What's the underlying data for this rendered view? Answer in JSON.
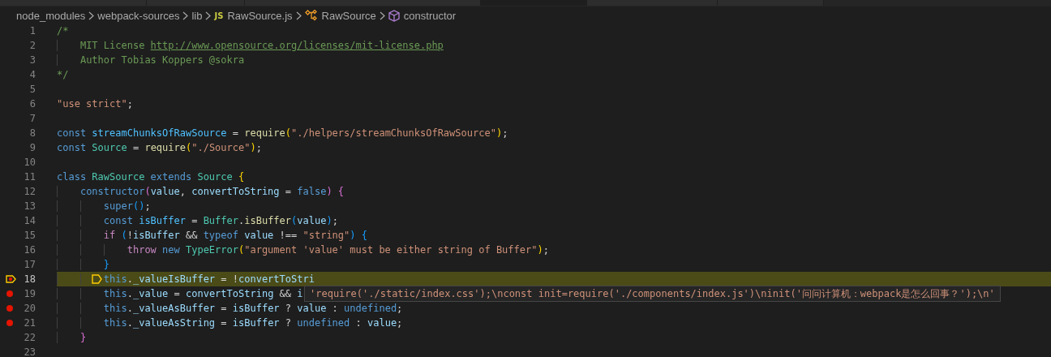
{
  "breadcrumbs": [
    {
      "kind": "folder",
      "label": "node_modules"
    },
    {
      "kind": "folder",
      "label": "webpack-sources"
    },
    {
      "kind": "folder",
      "label": "lib"
    },
    {
      "kind": "file",
      "icon_text": "JS",
      "label": "RawSource.js"
    },
    {
      "kind": "class",
      "label": "RawSource"
    },
    {
      "kind": "method",
      "label": "constructor"
    }
  ],
  "lines": [
    {
      "number": "1",
      "breakpoint": false,
      "current": false,
      "tokens": [
        {
          "kind": "comment",
          "text": "/*"
        }
      ]
    },
    {
      "number": "2",
      "breakpoint": false,
      "current": false,
      "tokens": [
        {
          "kind": "comment",
          "text": "    MIT License "
        },
        {
          "kind": "link",
          "text": "http://www.opensource.org/licenses/mit-license.php"
        }
      ]
    },
    {
      "number": "3",
      "breakpoint": false,
      "current": false,
      "tokens": [
        {
          "kind": "comment",
          "text": "    Author Tobias Koppers @sokra"
        }
      ]
    },
    {
      "number": "4",
      "breakpoint": false,
      "current": false,
      "tokens": [
        {
          "kind": "comment",
          "text": "*/"
        }
      ]
    },
    {
      "number": "5",
      "breakpoint": false,
      "current": false
    },
    {
      "number": "6",
      "breakpoint": false,
      "current": false,
      "tokens": [
        {
          "kind": "string",
          "text": "\"use strict\""
        },
        {
          "kind": "plain",
          "text": ";"
        }
      ]
    },
    {
      "number": "7",
      "breakpoint": false,
      "current": false
    },
    {
      "number": "8",
      "breakpoint": false,
      "current": false,
      "tokens": [
        {
          "kind": "keyword",
          "text": "const "
        },
        {
          "kind": "constant",
          "text": "streamChunksOfRawSource"
        },
        {
          "kind": "plain",
          "text": " = "
        },
        {
          "kind": "function",
          "text": "require"
        },
        {
          "kind": "bracket1",
          "text": "("
        },
        {
          "kind": "string",
          "text": "\"./helpers/streamChunksOfRawSource\""
        },
        {
          "kind": "bracket1",
          "text": ")"
        },
        {
          "kind": "plain",
          "text": ";"
        }
      ]
    },
    {
      "number": "9",
      "breakpoint": false,
      "current": false,
      "tokens": [
        {
          "kind": "keyword",
          "text": "const "
        },
        {
          "kind": "class",
          "text": "Source"
        },
        {
          "kind": "plain",
          "text": " = "
        },
        {
          "kind": "function",
          "text": "require"
        },
        {
          "kind": "bracket1",
          "text": "("
        },
        {
          "kind": "string",
          "text": "\"./Source\""
        },
        {
          "kind": "bracket1",
          "text": ")"
        },
        {
          "kind": "plain",
          "text": ";"
        }
      ]
    },
    {
      "number": "10",
      "breakpoint": false,
      "current": false
    },
    {
      "number": "11",
      "breakpoint": false,
      "current": false,
      "tokens": [
        {
          "kind": "keyword",
          "text": "class "
        },
        {
          "kind": "class",
          "text": "RawSource"
        },
        {
          "kind": "keyword",
          "text": " extends "
        },
        {
          "kind": "class",
          "text": "Source"
        },
        {
          "kind": "bracket1",
          "text": " {"
        }
      ]
    },
    {
      "number": "12",
      "breakpoint": false,
      "current": false,
      "tokens": [
        {
          "kind": "keyword",
          "text": "    constructor"
        },
        {
          "kind": "bracket2",
          "text": "("
        },
        {
          "kind": "variable",
          "text": "value"
        },
        {
          "kind": "plain",
          "text": ", "
        },
        {
          "kind": "variable",
          "text": "convertToString"
        },
        {
          "kind": "plain",
          "text": " = "
        },
        {
          "kind": "keyword",
          "text": "false"
        },
        {
          "kind": "bracket2",
          "text": ")"
        },
        {
          "kind": "bracket2",
          "text": " {"
        }
      ]
    },
    {
      "number": "13",
      "breakpoint": false,
      "current": false,
      "tokens": [
        {
          "kind": "keyword",
          "text": "        super"
        },
        {
          "kind": "bracket3",
          "text": "()"
        },
        {
          "kind": "plain",
          "text": ";"
        }
      ]
    },
    {
      "number": "14",
      "breakpoint": false,
      "current": false,
      "tokens": [
        {
          "kind": "keyword",
          "text": "        const "
        },
        {
          "kind": "constant",
          "text": "isBuffer"
        },
        {
          "kind": "plain",
          "text": " = "
        },
        {
          "kind": "class",
          "text": "Buffer"
        },
        {
          "kind": "plain",
          "text": "."
        },
        {
          "kind": "function",
          "text": "isBuffer"
        },
        {
          "kind": "bracket3",
          "text": "("
        },
        {
          "kind": "variable",
          "text": "value"
        },
        {
          "kind": "bracket3",
          "text": ")"
        },
        {
          "kind": "plain",
          "text": ";"
        }
      ]
    },
    {
      "number": "15",
      "breakpoint": false,
      "current": false,
      "tokens": [
        {
          "kind": "control",
          "text": "        if"
        },
        {
          "kind": "bracket3",
          "text": " ("
        },
        {
          "kind": "plain",
          "text": "!"
        },
        {
          "kind": "variable",
          "text": "isBuffer"
        },
        {
          "kind": "plain",
          "text": " && "
        },
        {
          "kind": "keyword",
          "text": "typeof"
        },
        {
          "kind": "variable",
          "text": " value"
        },
        {
          "kind": "plain",
          "text": " !== "
        },
        {
          "kind": "string",
          "text": "\"string\""
        },
        {
          "kind": "bracket3",
          "text": ")"
        },
        {
          "kind": "bracket3",
          "text": " {"
        }
      ]
    },
    {
      "number": "16",
      "breakpoint": false,
      "current": false,
      "tokens": [
        {
          "kind": "control",
          "text": "            throw"
        },
        {
          "kind": "keyword",
          "text": " new"
        },
        {
          "kind": "class",
          "text": " TypeError"
        },
        {
          "kind": "bracket1",
          "text": "("
        },
        {
          "kind": "string",
          "text": "\"argument 'value' must be either string of Buffer\""
        },
        {
          "kind": "bracket1",
          "text": ")"
        },
        {
          "kind": "plain",
          "text": ";"
        }
      ]
    },
    {
      "number": "17",
      "breakpoint": false,
      "current": false,
      "tokens": [
        {
          "kind": "bracket3",
          "text": "        }"
        }
      ]
    },
    {
      "number": "18",
      "breakpoint": true,
      "current": true,
      "tokens": [
        {
          "kind": "keyword",
          "text": "        this"
        },
        {
          "kind": "plain",
          "text": "."
        },
        {
          "kind": "variable",
          "text": "_valueIsBuffer"
        },
        {
          "kind": "plain",
          "text": " = !"
        },
        {
          "kind": "variable",
          "text": "convertToStri"
        }
      ]
    },
    {
      "number": "19",
      "breakpoint": true,
      "current": false,
      "tokens": [
        {
          "kind": "keyword",
          "text": "        this"
        },
        {
          "kind": "plain",
          "text": "."
        },
        {
          "kind": "variable",
          "text": "_value"
        },
        {
          "kind": "plain",
          "text": " = "
        },
        {
          "kind": "variable",
          "text": "convertToString"
        },
        {
          "kind": "plain",
          "text": " && "
        },
        {
          "kind": "variable",
          "text": "i"
        }
      ]
    },
    {
      "number": "20",
      "breakpoint": true,
      "current": false,
      "tokens": [
        {
          "kind": "keyword",
          "text": "        this"
        },
        {
          "kind": "plain",
          "text": "."
        },
        {
          "kind": "variable",
          "text": "_valueAsBuffer"
        },
        {
          "kind": "plain",
          "text": " = "
        },
        {
          "kind": "variable",
          "text": "isBuffer"
        },
        {
          "kind": "plain",
          "text": " ? "
        },
        {
          "kind": "variable",
          "text": "value"
        },
        {
          "kind": "plain",
          "text": " : "
        },
        {
          "kind": "keyword",
          "text": "undefined"
        },
        {
          "kind": "plain",
          "text": ";"
        }
      ]
    },
    {
      "number": "21",
      "breakpoint": true,
      "current": false,
      "tokens": [
        {
          "kind": "keyword",
          "text": "        this"
        },
        {
          "kind": "plain",
          "text": "."
        },
        {
          "kind": "variable",
          "text": "_valueAsString"
        },
        {
          "kind": "plain",
          "text": " = "
        },
        {
          "kind": "variable",
          "text": "isBuffer"
        },
        {
          "kind": "plain",
          "text": " ? "
        },
        {
          "kind": "keyword",
          "text": "undefined"
        },
        {
          "kind": "plain",
          "text": " : "
        },
        {
          "kind": "variable",
          "text": "value"
        },
        {
          "kind": "plain",
          "text": ";"
        }
      ]
    },
    {
      "number": "22",
      "breakpoint": false,
      "current": false,
      "tokens": [
        {
          "kind": "bracket2",
          "text": "    }"
        }
      ]
    },
    {
      "number": "23",
      "breakpoint": false,
      "current": false
    }
  ],
  "hover": {
    "text": "'require('./static/index.css');\\nconst init=require('./components/index.js')\\ninit('问问计算机：webpack是怎么回事？');\\n'"
  }
}
